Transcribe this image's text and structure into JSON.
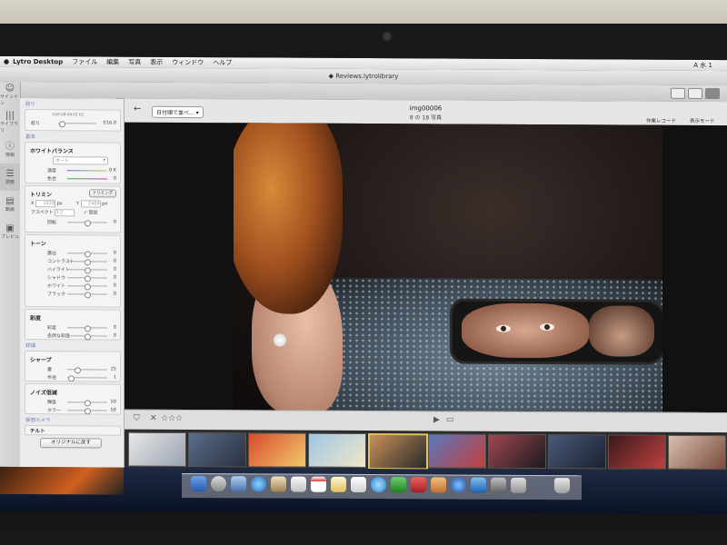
{
  "menubar": {
    "app": "Lytro Desktop",
    "items": [
      "ファイル",
      "編集",
      "写真",
      "表示",
      "ウィンドウ",
      "ヘルプ"
    ],
    "right": "A 水 1"
  },
  "window": {
    "title": "Reviews.lytrolibrary"
  },
  "rail": [
    {
      "label": "サインイン",
      "icon": "user-icon"
    },
    {
      "label": "ライブラリ",
      "icon": "library-icon"
    },
    {
      "label": "情報",
      "icon": "info-icon"
    },
    {
      "label": "調整",
      "icon": "sliders-icon"
    },
    {
      "label": "動画",
      "icon": "film-icon"
    },
    {
      "label": "プレビュ",
      "icon": "preview-icon"
    }
  ],
  "panel": {
    "aperture": {
      "section": "絞り",
      "ticks": "f/16 f/8 f/4 f/2 f/1",
      "label": "絞り",
      "value": "f/16.0",
      "position": 0.1
    },
    "basic_section": "基本",
    "white_balance": {
      "title": "ホワイトバランス",
      "preset": "オート",
      "rows": [
        {
          "label": "温度",
          "value": "0 K",
          "position": 0.5
        },
        {
          "label": "色合",
          "value": "0",
          "position": 0.5
        }
      ]
    },
    "crop": {
      "title": "トリミン",
      "button": "トリミング",
      "x_label": "X",
      "x_value": "2020",
      "x_unit": "px",
      "y_label": "Y",
      "y_value": "2404",
      "y_unit": "px",
      "aspect_label": "アスペクト",
      "aspect_value": "3:2",
      "lock_label": "固定",
      "rotate_label": "回転",
      "rotate_value": "0",
      "rotate_position": 0.5
    },
    "tone": {
      "title": "トーン",
      "rows": [
        {
          "label": "露出",
          "value": "0",
          "position": 0.5
        },
        {
          "label": "コントラスト",
          "value": "0",
          "position": 0.5
        },
        {
          "label": "ハイライト",
          "value": "0",
          "position": 0.5
        },
        {
          "label": "シャドウ",
          "value": "0",
          "position": 0.5
        },
        {
          "label": "ホワイト",
          "value": "0",
          "position": 0.5
        },
        {
          "label": "ブラック",
          "value": "0",
          "position": 0.5
        }
      ]
    },
    "saturation": {
      "title": "彩度",
      "rows": [
        {
          "label": "彩度",
          "value": "0",
          "position": 0.5
        },
        {
          "label": "自然な彩度",
          "value": "0",
          "position": 0.5
        }
      ]
    },
    "detail_section": "詳細",
    "sharpen": {
      "title": "シャープ",
      "rows": [
        {
          "label": "量",
          "value": "25",
          "position": 0.25
        },
        {
          "label": "半径",
          "value": "1",
          "position": 0.1
        }
      ]
    },
    "noise": {
      "title": "ノイズ低減",
      "rows": [
        {
          "label": "輝度",
          "value": "50",
          "position": 0.5
        },
        {
          "label": "カラー",
          "value": "50",
          "position": 0.5
        }
      ]
    },
    "virtual_camera": {
      "section": "仮想カメラ",
      "tilt": "チルト"
    },
    "reset_button": "オリジナルに戻す"
  },
  "viewer": {
    "sort_label": "日付順で並べ...",
    "image_name": "img00006",
    "image_count": "8 の 18 写真",
    "right_label_1": "作業レコード",
    "right_label_2": "表示モード"
  },
  "controls": {
    "flag_icon": "flag-icon",
    "reject": "✕",
    "stars": "☆☆☆",
    "play": "▶"
  },
  "colors": {
    "accent": "#6a7ab0",
    "selected_thumb": "#e3c25a"
  }
}
